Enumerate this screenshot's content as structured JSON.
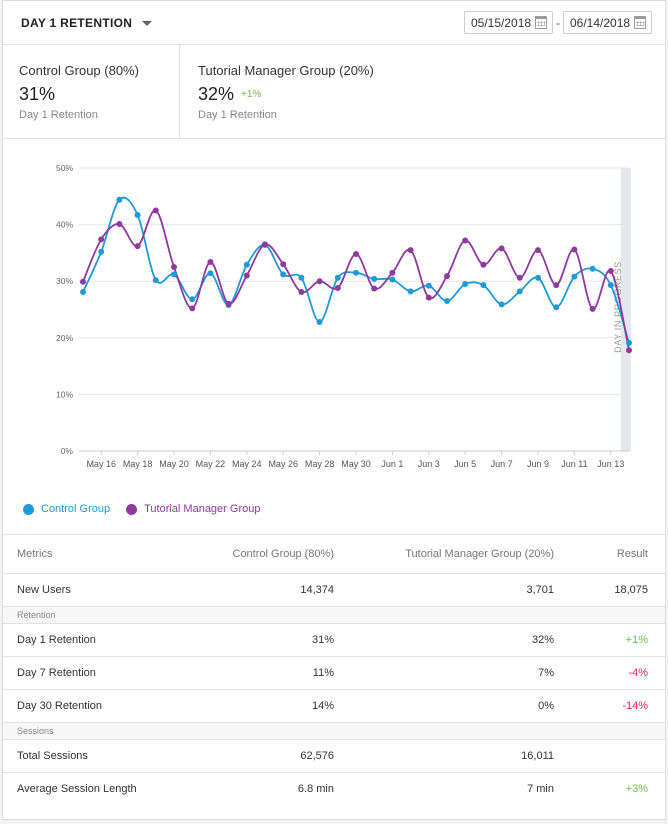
{
  "header": {
    "metric_label": "DAY 1 RETENTION",
    "start_date": "05/15/2018",
    "end_date": "06/14/2018",
    "date_separator": "-"
  },
  "summary": {
    "control": {
      "name": "Control Group (80%)",
      "value": "31%",
      "sub": "Day 1 Retention"
    },
    "tutorial": {
      "name": "Tutorial Manager Group (20%)",
      "value": "32%",
      "delta": "+1%",
      "sub": "Day 1 Retention"
    }
  },
  "colors": {
    "control": "#1f9ad6",
    "tutorial": "#8e3a9e",
    "positive": "#6cbf45",
    "negative": "#e0245e",
    "in_progress_band": "#e4e7ec"
  },
  "chart_data": {
    "type": "line",
    "title": "",
    "xlabel": "",
    "ylabel": "",
    "ylim": [
      0,
      50
    ],
    "y_ticks": [
      "0%",
      "10%",
      "20%",
      "30%",
      "40%",
      "50%"
    ],
    "x_tick_labels": [
      "May 16",
      "May 18",
      "May 20",
      "May 22",
      "May 24",
      "May 26",
      "May 28",
      "May 30",
      "Jun 1",
      "Jun 3",
      "Jun 5",
      "Jun 7",
      "Jun 9",
      "Jun 11",
      "Jun 13"
    ],
    "x": [
      "May 15",
      "May 16",
      "May 17",
      "May 18",
      "May 19",
      "May 20",
      "May 21",
      "May 22",
      "May 23",
      "May 24",
      "May 25",
      "May 26",
      "May 27",
      "May 28",
      "May 29",
      "May 30",
      "May 31",
      "Jun 1",
      "Jun 2",
      "Jun 3",
      "Jun 4",
      "Jun 5",
      "Jun 6",
      "Jun 7",
      "Jun 8",
      "Jun 9",
      "Jun 10",
      "Jun 11",
      "Jun 12",
      "Jun 13",
      "Jun 14"
    ],
    "series": [
      {
        "name": "Control Group",
        "values": [
          28.1,
          35.2,
          44.4,
          41.7,
          30.2,
          31.2,
          26.8,
          31.4,
          25.8,
          32.9,
          36.4,
          31.2,
          30.6,
          22.8,
          30.6,
          31.5,
          30.4,
          30.3,
          28.2,
          29.2,
          26.5,
          29.5,
          29.3,
          25.9,
          28.2,
          30.6,
          25.4,
          30.8,
          32.2,
          29.3,
          19.1
        ]
      },
      {
        "name": "Tutorial Manager Group",
        "values": [
          29.9,
          37.4,
          40.1,
          36.2,
          42.5,
          32.5,
          25.2,
          33.4,
          26.0,
          31.0,
          36.5,
          33.0,
          28.1,
          30.0,
          28.8,
          34.8,
          28.7,
          31.5,
          35.5,
          27.1,
          30.9,
          37.2,
          32.9,
          35.8,
          30.6,
          35.5,
          29.3,
          35.6,
          25.1,
          31.8,
          17.8
        ]
      }
    ],
    "in_progress_label": "DAY IN PROGRESS",
    "grid": true,
    "legend": "bottom-left"
  },
  "legend": {
    "control": "Control Group",
    "tutorial": "Tutorial Manager Group"
  },
  "table": {
    "headers": [
      "Metrics",
      "Control Group (80%)",
      "Tutorial Manager Group (20%)",
      "Result"
    ],
    "rows": [
      {
        "kind": "data",
        "metric": "New Users",
        "control": "14,374",
        "tutorial": "3,701",
        "result": "18,075",
        "tone": ""
      },
      {
        "kind": "section",
        "label": "Retention"
      },
      {
        "kind": "data",
        "metric": "Day 1 Retention",
        "control": "31%",
        "tutorial": "32%",
        "result": "+1%",
        "tone": "pos"
      },
      {
        "kind": "data",
        "metric": "Day 7 Retention",
        "control": "11%",
        "tutorial": "7%",
        "result": "-4%",
        "tone": "neg"
      },
      {
        "kind": "data",
        "metric": "Day 30 Retention",
        "control": "14%",
        "tutorial": "0%",
        "result": "-14%",
        "tone": "neg"
      },
      {
        "kind": "section",
        "label": "Sessions"
      },
      {
        "kind": "data",
        "metric": "Total Sessions",
        "control": "62,576",
        "tutorial": "16,011",
        "result": "",
        "tone": ""
      },
      {
        "kind": "data",
        "metric": "Average Session Length",
        "control": "6.8 min",
        "tutorial": "7 min",
        "result": "+3%",
        "tone": "pos"
      }
    ]
  }
}
